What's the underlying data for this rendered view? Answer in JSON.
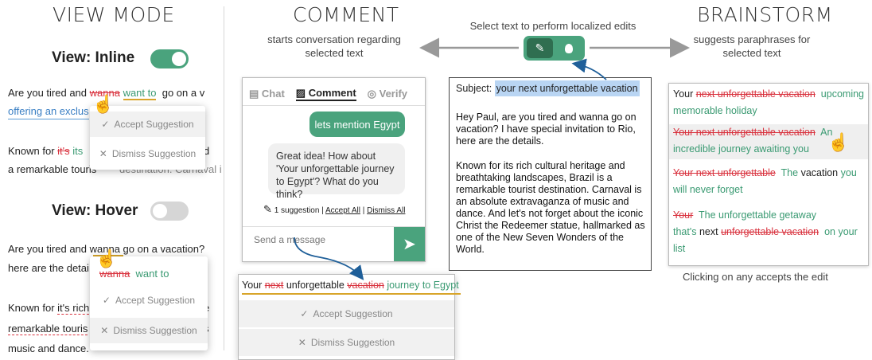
{
  "colors": {
    "accent": "#4aa37d",
    "strike": "#d9333f",
    "highlight": "#b9d5f3",
    "underline": "#d8a52a"
  },
  "view_mode": {
    "title": "VIEW MODE",
    "inline_label": "View: Inline",
    "hover_label": "View: Hover",
    "inline_line1_pre": "Are you tired and ",
    "inline_line1_del": "wanna",
    "inline_line1_ins": "want to",
    "inline_line1_post": "go on a v",
    "inline_line2": "offering an exclus",
    "inline_line3_pre": "Known for ",
    "inline_line3_del": "it's",
    "inline_line3_ins": "its",
    "inline_line3_post": "d",
    "inline_line4": "a remarkable touris",
    "accept": "Accept Suggestion",
    "dismiss": "Dismiss Suggestion",
    "hover_line1": "Are you tired and wanna go on a vacation?",
    "hover_line2": "here are the detai",
    "hover_pop_del": "wanna",
    "hover_pop_ins": "want to",
    "hover_line3_pre": "Known for ",
    "hover_line3_mark": "it's rich",
    "hover_line3_post": "e",
    "hover_line4": "remarkable touris",
    "hover_line4_post": "s",
    "hover_line5": "music and dance."
  },
  "comment": {
    "title": "COMMENT",
    "subtitle1": "starts conversation regarding",
    "subtitle2": "selected text",
    "tab_chat": "Chat",
    "tab_comment": "Comment",
    "tab_verify": "Verify",
    "user_msg": "lets mention Egypt",
    "bot_msg": "Great idea! How about 'Your unforgettable journey to Egypt'? What do you think?",
    "suggestion_count": "1 suggestion",
    "accept_all": "Accept All",
    "dismiss_all": "Dismiss All",
    "input_placeholder": "Send a message",
    "result_pre": "Your ",
    "result_del1": "next",
    "result_mid": " unforgettable ",
    "result_del2": "vacation",
    "result_ins": "journey to Egypt",
    "accept": "Accept Suggestion",
    "dismiss": "Dismiss Suggestion"
  },
  "center": {
    "caption": "Select text to perform localized edits",
    "subject_label": "Subject:",
    "subject_value": "your next unforgettable vacation",
    "para1": "Hey Paul, are you tired and wanna go on vacation? I have special invitation to Rio, here are the details.",
    "para2": "Known for its rich cultural heritage and breathtaking landscapes, Brazil is a remarkable tourist destination. Carnaval is an absolute extravaganza of music and dance. And let's not forget about the iconic Christ the Redeemer statue, hallmarked as one of the New Seven Wonders of the World."
  },
  "brainstorm": {
    "title": "BRAINSTORM",
    "subtitle1": "suggests paraphrases for",
    "subtitle2": "selected text",
    "footer": "Clicking on any accepts the edit",
    "s1_pre": "Your ",
    "s1_del": "next unforgettable vacation",
    "s1_ins": "upcoming",
    "s1_line2": "memorable holiday",
    "s2_del": "Your next unforgettable vacation",
    "s2_ins": "An",
    "s2_line2": "incredible journey awaiting you",
    "s3_del": "Your next unforgettable",
    "s3_ins1": "The",
    "s3_keep": "vacation",
    "s3_ins2": "you",
    "s3_line2": "will never forget",
    "s4_del": "Your",
    "s4_ins": "The unforgettable getaway",
    "s4_l2_ins": "that's",
    "s4_l2_keep": "next",
    "s4_l2_del": "unforgettable vacation",
    "s4_l2_ins2": "on your",
    "s4_line3": "list"
  }
}
